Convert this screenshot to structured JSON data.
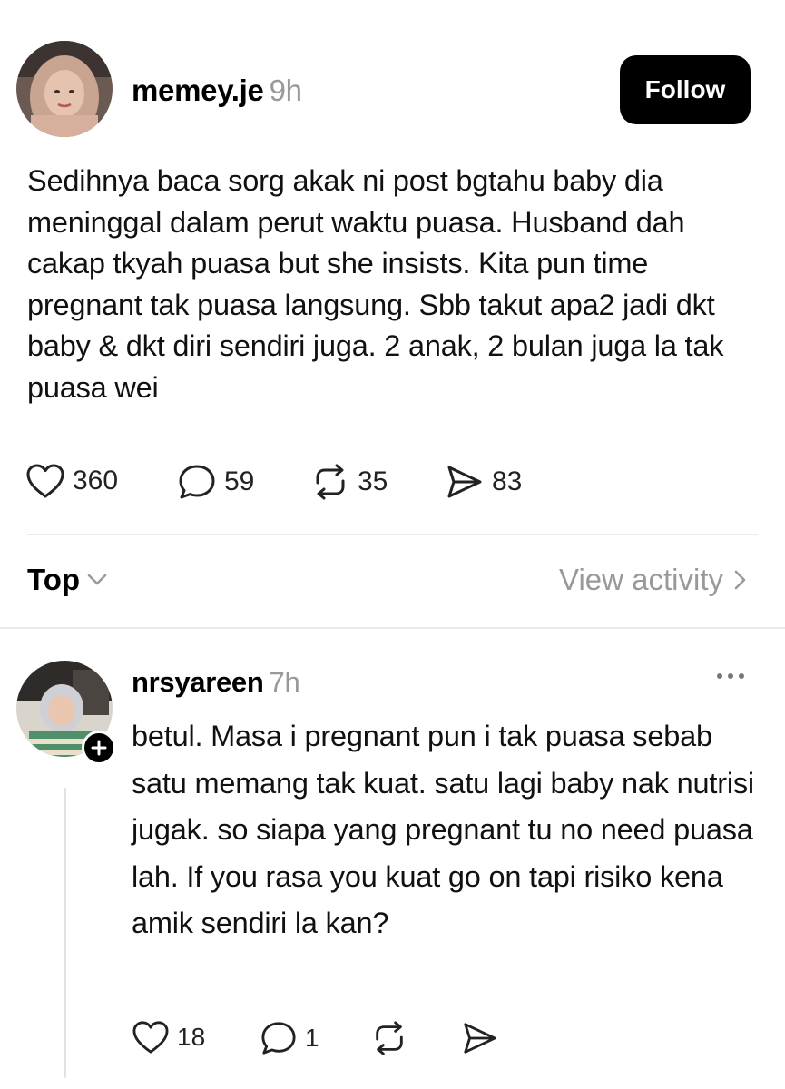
{
  "post": {
    "username": "memey.je",
    "time": "9h",
    "follow_label": "Follow",
    "text": "Sedihnya baca sorg akak ni post bgtahu baby dia meninggal dalam perut waktu puasa. Husband dah cakap tkyah puasa but she insists. Kita pun time pregnant tak puasa langsung. Sbb takut apa2 jadi dkt baby & dkt diri sendiri juga. 2 anak, 2 bulan juga la tak puasa wei",
    "likes": "360",
    "comments": "59",
    "reposts": "35",
    "shares": "83"
  },
  "replies_bar": {
    "sort_label": "Top",
    "view_activity_label": "View activity"
  },
  "reply": {
    "username": "nrsyareen",
    "time": "7h",
    "text": "betul. Masa i pregnant pun i tak puasa sebab satu memang tak kuat. satu lagi baby nak nutrisi jugak. so siapa yang pregnant tu no need puasa lah. If you rasa you kuat go on tapi risiko kena amik sendiri la kan?",
    "likes": "18",
    "comments": "1"
  },
  "icons": {
    "like": "heart-icon",
    "comment": "speech-bubble-icon",
    "repost": "repost-icon",
    "share": "send-icon",
    "more": "more-dots-icon",
    "follow": "plus-icon"
  },
  "colors": {
    "accent": "#000000",
    "muted": "#999999",
    "divider": "#ebebeb"
  }
}
